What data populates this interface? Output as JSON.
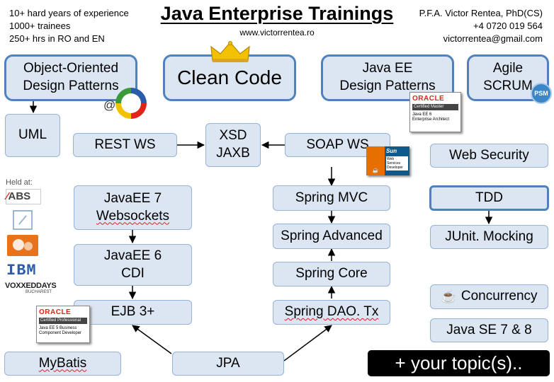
{
  "header": {
    "left_lines": [
      "10+ hard years of experience",
      "1000+ trainees",
      "250+ hrs in RO and EN"
    ],
    "title": "Java Enterprise Trainings",
    "website": "www.victorrentea.ro",
    "right_lines": [
      "P.F.A. Victor Rentea, PhD(CS)",
      "+4 0720 019 564",
      "victorrentea@gmail.com"
    ]
  },
  "boxes": {
    "oodp": [
      "Object-Oriented",
      "Design Patterns"
    ],
    "clean_code": "Clean Code",
    "javaee_dp": [
      "Java EE",
      "Design Patterns"
    ],
    "agile": [
      "Agile",
      "SCRUM"
    ],
    "uml": "UML",
    "rest_ws": "REST WS",
    "xsd_jaxb": [
      "XSD",
      "JAXB"
    ],
    "soap_ws": "SOAP WS",
    "web_security": "Web Security",
    "javaee7": [
      "JavaEE 7",
      "Websockets"
    ],
    "spring_mvc": "Spring MVC",
    "tdd": "TDD",
    "javaee6": [
      "JavaEE 6",
      "CDI"
    ],
    "spring_advanced": "Spring Advanced",
    "junit": "JUnit. Mocking",
    "spring_core": "Spring Core",
    "ejb3": "EJB 3+",
    "spring_dao": "Spring DAO. Tx",
    "concurrency": "Concurrency",
    "javase": "Java SE 7 & 8",
    "mybatis": "MyBatis",
    "jpa": "JPA",
    "your_topic": "+ your topic(s).."
  },
  "badges": {
    "at_sign": "@",
    "psm": "PSM",
    "oracle_master": {
      "brand": "ORACLE",
      "cert": "Certified Master",
      "line1": "Java EE 6",
      "line2": "Enterprise Architect"
    },
    "sun": {
      "brand": "Sun",
      "line1": "Web Services",
      "line2": "Developer"
    },
    "oracle_pro": {
      "brand": "ORACLE",
      "cert": "Certified Professional",
      "line1": "Java EE 5 Business",
      "line2": "Component Developer"
    }
  },
  "held_at": {
    "label": "Held at:",
    "logos": [
      "ABS",
      "IBM",
      "VOXXEDDAYS",
      "BUCHAREST"
    ]
  }
}
